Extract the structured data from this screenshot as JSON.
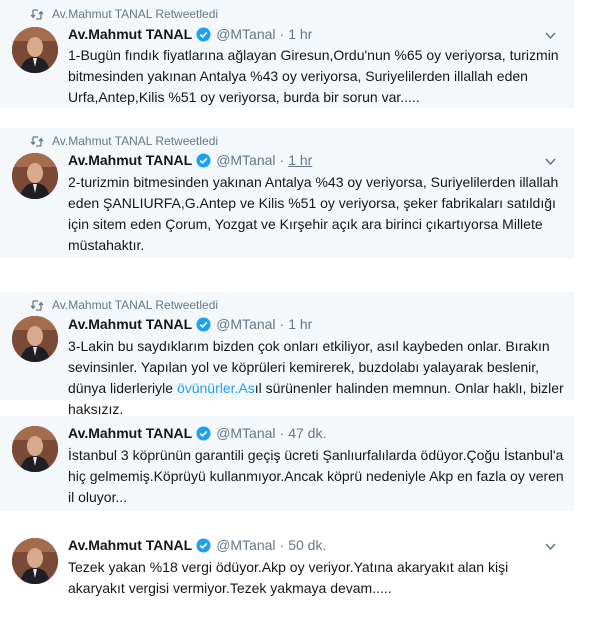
{
  "tweets": [
    {
      "retweet_label": "Av.Mahmut TANAL Retweetledi",
      "name": "Av.Mahmut TANAL",
      "handle": "@MTanal",
      "separator": "·",
      "time": "1 hr",
      "text": "1-Bugün fındık fiyatlarına ağlayan Giresun,Ordu'nun %65 oy veriyorsa, turizmin bitmesinden yakınan Antalya %43 oy veriyorsa, Suriyelilerden illallah eden Urfa,Antep,Kilis %51 oy veriyorsa, burda bir sorun var....."
    },
    {
      "retweet_label": "Av.Mahmut TANAL Retweetledi",
      "name": "Av.Mahmut TANAL",
      "handle": "@MTanal",
      "separator": "·",
      "time": "1 hr",
      "text": "2-turizmin bitmesinden yakınan Antalya %43 oy veriyorsa, Suriyelilerden illallah eden ŞANLIURFA,G.Antep ve Kilis %51 oy veriyorsa, şeker fabrikaları satıldığı için sitem eden Çorum, Yozgat ve Kırşehir açık ara birinci çıkartıyorsa Millete müstahaktır."
    },
    {
      "retweet_label": "Av.Mahmut TANAL Retweetledi",
      "name": "Av.Mahmut TANAL",
      "handle": "@MTanal",
      "separator": "·",
      "time": "1 hr",
      "text_before": "3-Lakin bu saydıklarım bizden çok onları etkiliyor, asıl kaybeden onlar. Bırakın sevinsinler. Yapılan yol ve köprüleri kemirerek, buzdolabı yalayarak beslenir, dünya liderleriyle ",
      "text_link": "övünürler.As",
      "text_after": "ıl sürünenler halinden memnun. Onlar haklı, bizler haksızız."
    },
    {
      "name": "Av.Mahmut TANAL",
      "handle": "@MTanal",
      "separator": "·",
      "time": "47 dk.",
      "text": "İstanbul 3 köprünün garantili geçiş ücreti Şanlıurfalılarda ödüyor.Çoğu İstanbul'a hiç gelmemiş.Köprüyü kullanmıyor.Ancak köprü nedeniyle Akp en fazla oy veren il oluyor..."
    },
    {
      "name": "Av.Mahmut TANAL",
      "handle": "@MTanal",
      "separator": "·",
      "time": "50 dk.",
      "text": "Tezek yakan %18 vergi ödüyor.Akp oy veriyor.Yatına akaryakıt alan kişi akaryakıt vergisi vermiyor.Tezek yakmaya devam....."
    }
  ],
  "colors": {
    "link": "#1da1f2",
    "meta": "#657786",
    "tweet_bg": "#f5f8fa"
  },
  "icons": [
    "retweet-icon",
    "verified-badge-icon",
    "chevron-down-icon"
  ]
}
